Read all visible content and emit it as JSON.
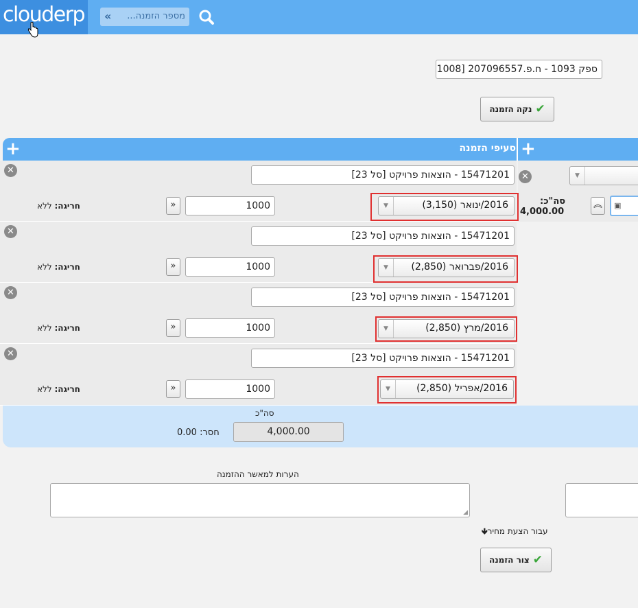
{
  "header": {
    "logo": "clouderp",
    "order_search_placeholder": "מספר הזמנה...",
    "order_search_chevron": "«",
    "search_icon": "search-icon"
  },
  "supplier": {
    "value": "ספק 1093 - ח.פ.207096557 [1008"
  },
  "clean_order_button": "נקה הזמנה",
  "lines_section": {
    "title": "סעיפי הזמנה",
    "add_icon": "+"
  },
  "item_panel": {
    "total_label": "סה\"כ:",
    "total_value": "4,000.00"
  },
  "lines": [
    {
      "account": "15471201 - הוצאות פרויקט [סל 23]",
      "budget": "2016/ינואר (3,150)",
      "quantity": "1000",
      "deviation_label": "חריגה:",
      "deviation_value": "ללא"
    },
    {
      "account": "15471201 - הוצאות פרויקט [סל 23]",
      "budget": "2016/פברואר (2,850)",
      "quantity": "1000",
      "deviation_label": "חריגה:",
      "deviation_value": "ללא"
    },
    {
      "account": "15471201 - הוצאות פרויקט [סל 23]",
      "budget": "2016/מרץ (2,850)",
      "quantity": "1000",
      "deviation_label": "חריגה:",
      "deviation_value": "ללא"
    },
    {
      "account": "15471201 - הוצאות פרויקט [סל 23]",
      "budget": "2016/אפריל (2,850)",
      "quantity": "1000",
      "deviation_label": "חריגה:",
      "deviation_value": "ללא"
    }
  ],
  "totals": {
    "label": "סה\"כ",
    "value": "4,000.00",
    "missing_label": "חסר:",
    "missing_value": "0.00"
  },
  "notes": {
    "label": "הערות למאשר ההזמנה"
  },
  "price_offer_link": "עבור הצעת מחיר",
  "create_order_button": "צור הזמנה",
  "colors": {
    "header_blue": "#5faef2",
    "logo_blue": "#3d8fe0",
    "totals_bg": "#cde5fb",
    "highlight_red": "#e03030",
    "check_green": "#3aa63a"
  }
}
